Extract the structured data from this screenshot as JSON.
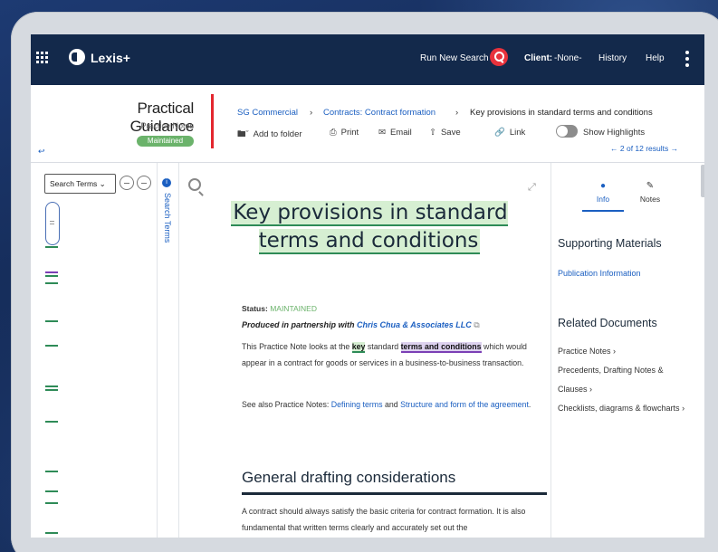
{
  "nav": {
    "app_name": "Lexis+",
    "run_search": "Run New Search",
    "client_label": "Client:",
    "client_value": "-None-",
    "history": "History",
    "help": "Help"
  },
  "header": {
    "title": "Practical Guidance",
    "subtitle": "Practice Notes",
    "badge": "Maintained",
    "breadcrumb": [
      "SG Commercial",
      "Contracts: Contract formation",
      "Key provisions in standard terms and conditions"
    ],
    "tools": {
      "add_folder": "Add to folder",
      "print": "Print",
      "email": "Email",
      "save": "Save",
      "link": "Link",
      "show_highlights": "Show Highlights"
    },
    "results": "2 of 12 results"
  },
  "left": {
    "select_value": "Search Terms",
    "vertical_label": "Search Terms"
  },
  "doc": {
    "title": "Key provisions in standard terms and conditions",
    "status_label": "Status:",
    "status_value": "MAINTAINED",
    "produced_prefix": "Produced in partnership with",
    "produced_partner": "Chris Chua & Associates LLC",
    "p1_a": "This Practice Note looks at the",
    "p1_key": "key",
    "p1_b": "standard",
    "p1_terms": "terms and conditions",
    "p1_c": "which would appear in a contract for goods or services in a business-to-business transaction.",
    "p2_a": "See also Practice Notes:",
    "p2_link1": "Defining terms",
    "p2_and": "and",
    "p2_link2": "Structure and form of the agreement",
    "p2_end": ".",
    "h2": "General drafting considerations",
    "p3": "A contract should always satisfy the basic criteria for contract formation. It is also fundamental that written terms clearly and accurately set out the"
  },
  "right": {
    "tab_info": "Info",
    "tab_notes": "Notes",
    "supporting_heading": "Supporting Materials",
    "publication_info": "Publication Information",
    "related_heading": "Related Documents",
    "related_items": [
      "Practice Notes",
      "Precedents, Drafting Notes & Clauses",
      "Checklists, diagrams & flowcharts"
    ]
  },
  "colors": {
    "nav_bg": "#13294b",
    "accent_red": "#e3262e",
    "link_blue": "#1b5fc1",
    "status_green": "#6bb36b",
    "highlight_green": "#d6efd2",
    "highlight_purple": "#ddd2ef"
  }
}
